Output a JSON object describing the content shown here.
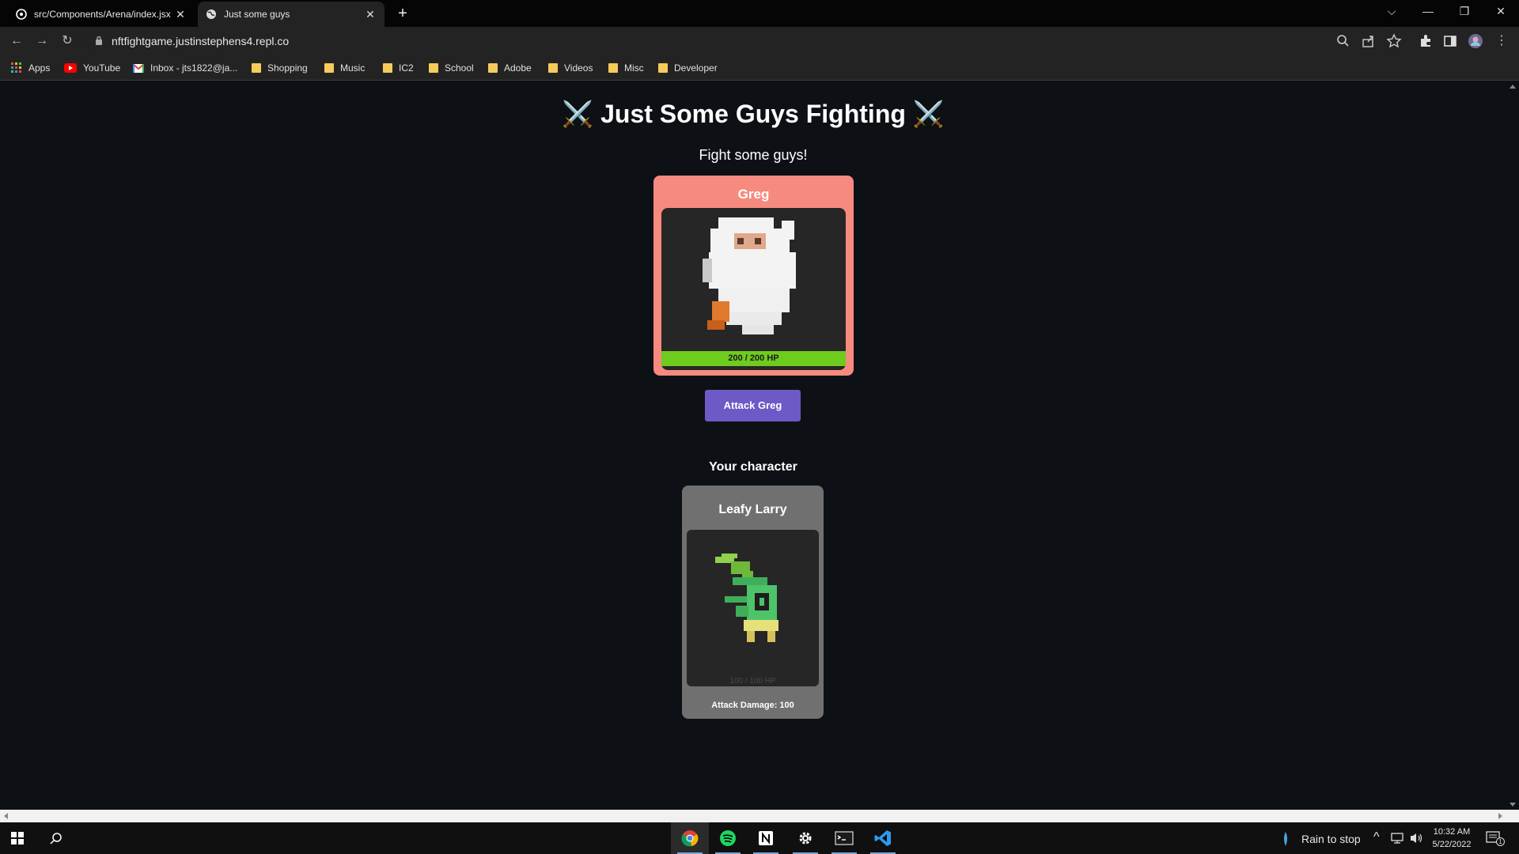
{
  "browser": {
    "tabs": [
      {
        "title": "src/Components/Arena/index.jsx",
        "active": false
      },
      {
        "title": "Just some guys",
        "active": true
      }
    ],
    "url": "nftfightgame.justinstephens4.repl.co",
    "bookmarks": [
      {
        "label": "Apps",
        "icon": "apps-grid-icon"
      },
      {
        "label": "YouTube",
        "icon": "youtube-icon"
      },
      {
        "label": "Inbox - jts1822@ja...",
        "icon": "gmail-icon"
      },
      {
        "label": "Shopping",
        "icon": "folder-icon"
      },
      {
        "label": "Music",
        "icon": "folder-icon"
      },
      {
        "label": "IC2",
        "icon": "folder-icon"
      },
      {
        "label": "School",
        "icon": "folder-icon"
      },
      {
        "label": "Adobe",
        "icon": "folder-icon"
      },
      {
        "label": "Videos",
        "icon": "folder-icon"
      },
      {
        "label": "Misc",
        "icon": "folder-icon"
      },
      {
        "label": "Developer",
        "icon": "folder-icon"
      }
    ]
  },
  "page": {
    "title": "⚔️ Just Some Guys Fighting ⚔️",
    "subtitle": "Fight some guys!",
    "boss": {
      "name": "Greg",
      "hp": 200,
      "max_hp": 200,
      "hp_text": "200 / 200 HP",
      "hp_fraction": 1.0,
      "card_color": "#f78a7e",
      "hp_color": "#6fcb1e"
    },
    "attack_button": "Attack Greg",
    "attack_button_color": "#6e5ac6",
    "your_character_label": "Your character",
    "player": {
      "name": "Leafy Larry",
      "hp_text": "100 / 100 HP",
      "attack_damage": "Attack Damage: 100"
    }
  },
  "taskbar": {
    "weather": "Rain to stop",
    "time": "10:32 AM",
    "date": "5/22/2022",
    "notification_count": "1",
    "apps": [
      "chrome-icon",
      "spotify-icon",
      "notion-icon",
      "settings-icon",
      "terminal-icon",
      "vscode-icon"
    ]
  }
}
